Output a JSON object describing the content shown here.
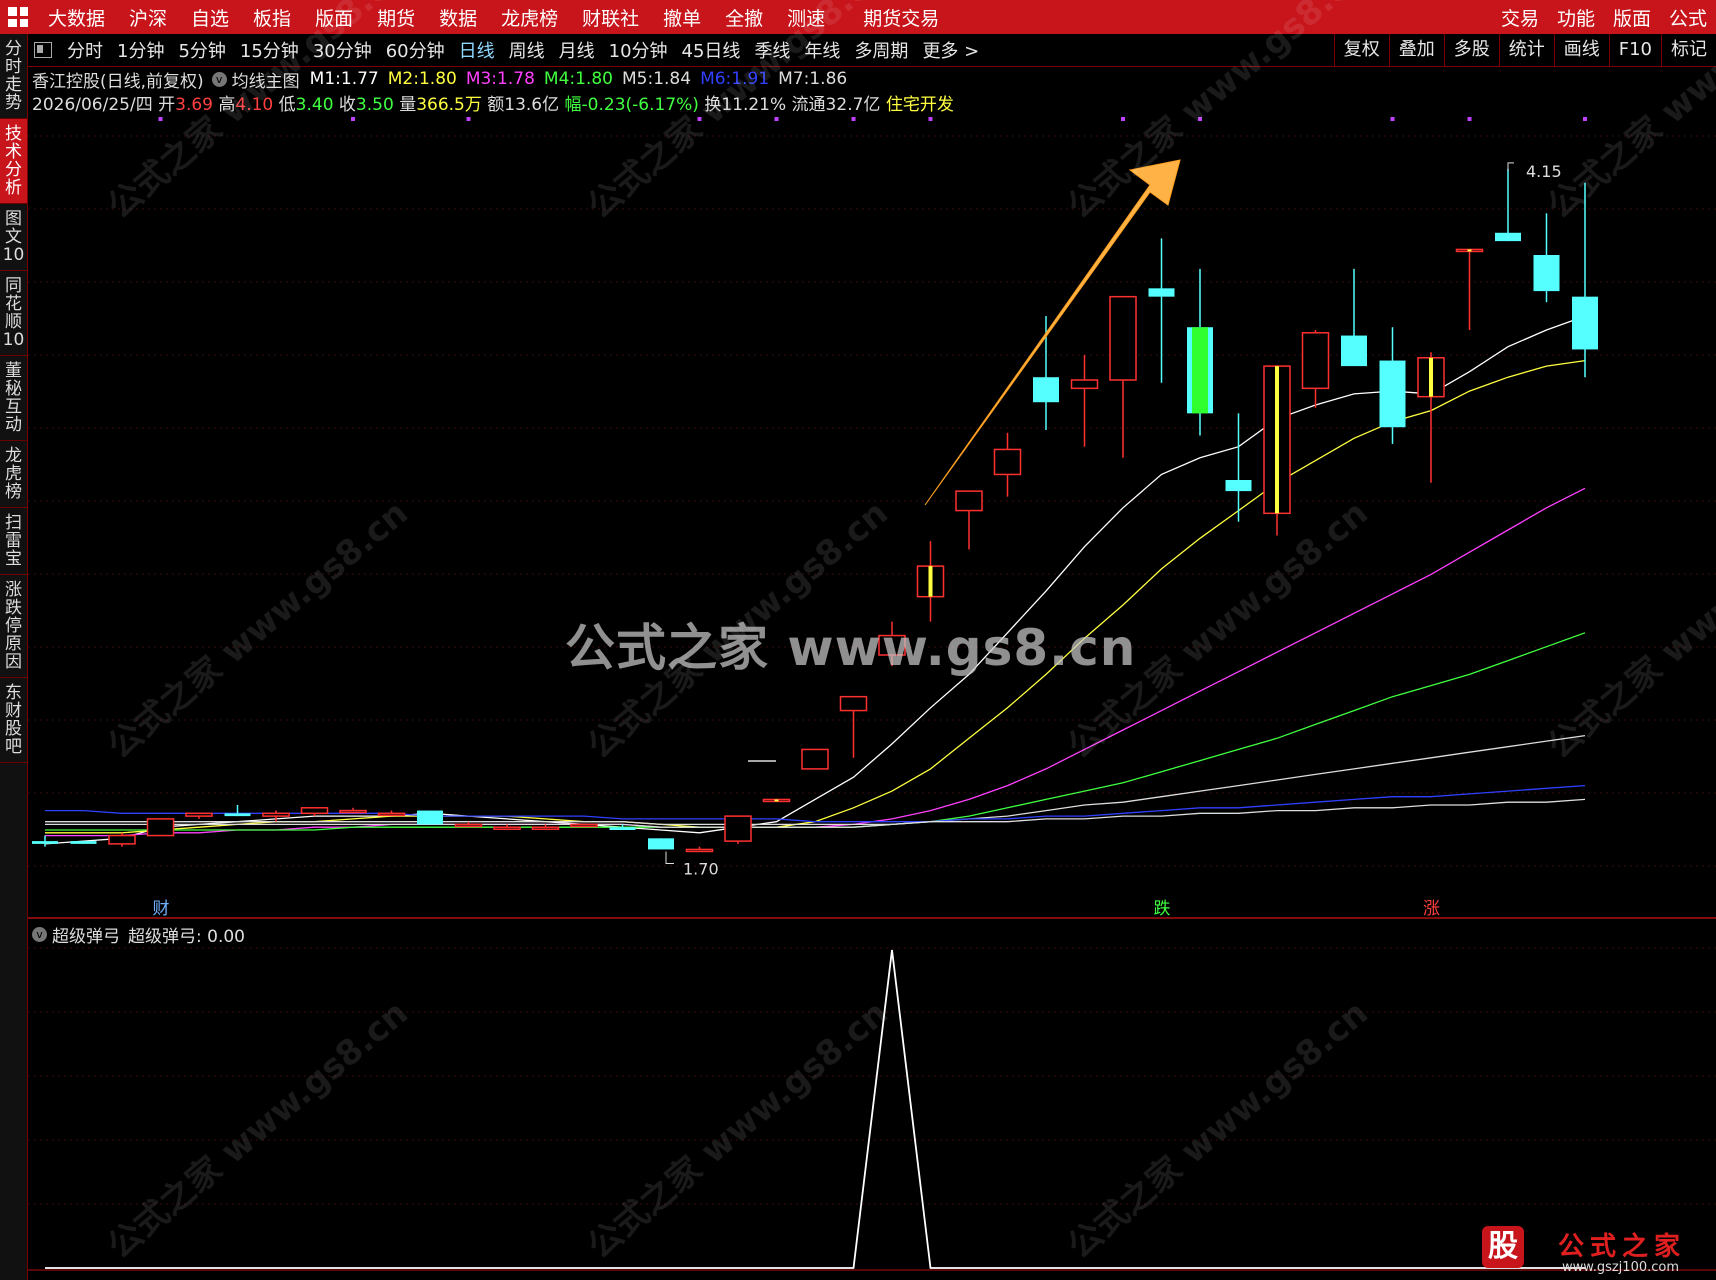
{
  "top_menu": {
    "left": [
      "大数据",
      "沪深",
      "自选",
      "板指",
      "版面",
      "期货",
      "数据",
      "龙虎榜",
      "财联社",
      "撤单",
      "全撤",
      "测速",
      "期货交易"
    ],
    "right": [
      "交易",
      "功能",
      "版面",
      "公式"
    ]
  },
  "toolbar": {
    "periods": [
      "分时",
      "1分钟",
      "5分钟",
      "15分钟",
      "30分钟",
      "60分钟",
      "日线",
      "周线",
      "月线",
      "10分钟",
      "45日线",
      "季线",
      "年线",
      "多周期",
      "更多 >"
    ],
    "active": "日线",
    "right": [
      "复权",
      "叠加",
      "多股",
      "统计",
      "画线",
      "F10",
      "标记"
    ]
  },
  "sidebar": {
    "tabs": [
      "分时走势",
      "技术分析",
      "图文10",
      "同花顺10",
      "董秘互动",
      "龙虎榜",
      "扫雷宝",
      "涨跌停原因",
      "东财股吧"
    ],
    "active": "技术分析"
  },
  "info": {
    "stock": "香江控股(日线,前复权)",
    "indicator": "均线主图",
    "ma": [
      {
        "label": "M1:",
        "value": "1.77",
        "color": "#ffffff"
      },
      {
        "label": "M2:",
        "value": "1.80",
        "color": "#ffff40"
      },
      {
        "label": "M3:",
        "value": "1.78",
        "color": "#ff40ff"
      },
      {
        "label": "M4:",
        "value": "1.80",
        "color": "#40ff40"
      },
      {
        "label": "M5:",
        "value": "1.84",
        "color": "#dddddd"
      },
      {
        "label": "M6:",
        "value": "1.91",
        "color": "#3040ff"
      },
      {
        "label": "M7:",
        "value": "1.86",
        "color": "#dddddd"
      }
    ],
    "line2": [
      {
        "text": "2026/06/25/四 ",
        "color": "#dddddd"
      },
      {
        "text": "开",
        "color": "#dddddd"
      },
      {
        "text": "3.69 ",
        "color": "#ff4040"
      },
      {
        "text": "高",
        "color": "#dddddd"
      },
      {
        "text": "4.10 ",
        "color": "#ff4040"
      },
      {
        "text": "低",
        "color": "#dddddd"
      },
      {
        "text": "3.40 ",
        "color": "#40ff40"
      },
      {
        "text": "收",
        "color": "#dddddd"
      },
      {
        "text": "3.50 ",
        "color": "#40ff40"
      },
      {
        "text": "量",
        "color": "#dddddd"
      },
      {
        "text": "366.5万 ",
        "color": "#ffff40"
      },
      {
        "text": "额13.6亿 ",
        "color": "#dddddd"
      },
      {
        "text": "幅-0.23(-6.17%) ",
        "color": "#40ff40"
      },
      {
        "text": "换11.21% ",
        "color": "#dddddd"
      },
      {
        "text": "流通32.7亿 ",
        "color": "#dddddd"
      },
      {
        "text": "住宅开发",
        "color": "#ffff40"
      }
    ]
  },
  "chart_data": [
    {
      "type": "candlestick",
      "title": "香江控股(日线,前复权)",
      "candles": [
        {
          "o": 1.73,
          "h": 1.75,
          "l": 1.71,
          "c": 1.72
        },
        {
          "o": 1.73,
          "h": 1.73,
          "l": 1.72,
          "c": 1.72
        },
        {
          "o": 1.72,
          "h": 1.76,
          "l": 1.71,
          "c": 1.75
        },
        {
          "o": 1.75,
          "h": 1.81,
          "l": 1.75,
          "c": 1.81
        },
        {
          "o": 1.82,
          "h": 1.83,
          "l": 1.81,
          "c": 1.83
        },
        {
          "o": 1.83,
          "h": 1.86,
          "l": 1.82,
          "c": 1.82
        },
        {
          "o": 1.82,
          "h": 1.84,
          "l": 1.8,
          "c": 1.83
        },
        {
          "o": 1.83,
          "h": 1.85,
          "l": 1.82,
          "c": 1.85
        },
        {
          "o": 1.84,
          "h": 1.85,
          "l": 1.83,
          "c": 1.84
        },
        {
          "o": 1.83,
          "h": 1.84,
          "l": 1.82,
          "c": 1.83
        },
        {
          "o": 1.84,
          "h": 1.84,
          "l": 1.79,
          "c": 1.79
        },
        {
          "o": 1.79,
          "h": 1.8,
          "l": 1.78,
          "c": 1.79
        },
        {
          "o": 1.78,
          "h": 1.79,
          "l": 1.77,
          "c": 1.78
        },
        {
          "o": 1.78,
          "h": 1.79,
          "l": 1.77,
          "c": 1.78
        },
        {
          "o": 1.79,
          "h": 1.79,
          "l": 1.78,
          "c": 1.79
        },
        {
          "o": 1.78,
          "h": 1.79,
          "l": 1.77,
          "c": 1.77
        },
        {
          "o": 1.74,
          "h": 1.74,
          "l": 1.7,
          "c": 1.7
        },
        {
          "o": 1.7,
          "h": 1.71,
          "l": 1.7,
          "c": 1.7
        },
        {
          "o": 1.73,
          "h": 1.82,
          "l": 1.72,
          "c": 1.82
        },
        {
          "o": 1.88,
          "h": 1.88,
          "l": 1.88,
          "c": 1.88
        },
        {
          "o": 1.99,
          "h": 2.06,
          "l": 1.99,
          "c": 2.06
        },
        {
          "o": 2.2,
          "h": 2.25,
          "l": 2.03,
          "c": 2.25
        },
        {
          "o": 2.4,
          "h": 2.52,
          "l": 2.36,
          "c": 2.47
        },
        {
          "o": 2.61,
          "h": 2.81,
          "l": 2.52,
          "c": 2.72
        },
        {
          "o": 2.92,
          "h": 2.99,
          "l": 2.78,
          "c": 2.99
        },
        {
          "o": 3.05,
          "h": 3.2,
          "l": 2.97,
          "c": 3.14
        },
        {
          "o": 3.4,
          "h": 3.62,
          "l": 3.21,
          "c": 3.31
        },
        {
          "o": 3.36,
          "h": 3.48,
          "l": 3.15,
          "c": 3.39
        },
        {
          "o": 3.39,
          "h": 3.66,
          "l": 3.11,
          "c": 3.69
        },
        {
          "o": 3.72,
          "h": 3.9,
          "l": 3.38,
          "c": 3.69
        },
        {
          "o": 3.58,
          "h": 3.79,
          "l": 3.19,
          "c": 3.27
        },
        {
          "o": 3.03,
          "h": 3.27,
          "l": 2.88,
          "c": 2.99
        },
        {
          "o": 2.91,
          "h": 3.44,
          "l": 2.83,
          "c": 3.44
        },
        {
          "o": 3.36,
          "h": 3.57,
          "l": 3.29,
          "c": 3.56
        },
        {
          "o": 3.55,
          "h": 3.79,
          "l": 3.46,
          "c": 3.44
        },
        {
          "o": 3.46,
          "h": 3.58,
          "l": 3.16,
          "c": 3.22
        },
        {
          "o": 3.33,
          "h": 3.49,
          "l": 3.02,
          "c": 3.47
        },
        {
          "o": 3.86,
          "h": 3.86,
          "l": 3.57,
          "c": 3.86
        },
        {
          "o": 3.92,
          "h": 4.15,
          "l": 3.89,
          "c": 3.89
        },
        {
          "o": 3.84,
          "h": 3.99,
          "l": 3.67,
          "c": 3.71
        },
        {
          "o": 3.69,
          "h": 4.1,
          "l": 3.4,
          "c": 3.5
        }
      ],
      "ma_series": [
        {
          "name": "M1",
          "color": "#ffffff",
          "values": [
            1.72,
            1.73,
            1.74,
            1.78,
            1.79,
            1.8,
            1.81,
            1.82,
            1.82,
            1.82,
            1.83,
            1.82,
            1.81,
            1.8,
            1.79,
            1.78,
            1.77,
            1.76,
            1.78,
            1.8,
            1.88,
            1.96,
            2.08,
            2.21,
            2.33,
            2.48,
            2.63,
            2.79,
            2.93,
            3.05,
            3.11,
            3.15,
            3.25,
            3.3,
            3.34,
            3.35,
            3.34,
            3.42,
            3.51,
            3.57,
            3.62
          ]
        },
        {
          "name": "M2",
          "color": "#ffff40",
          "values": [
            1.76,
            1.76,
            1.76,
            1.77,
            1.78,
            1.79,
            1.8,
            1.8,
            1.81,
            1.82,
            1.82,
            1.82,
            1.82,
            1.81,
            1.8,
            1.8,
            1.79,
            1.78,
            1.78,
            1.78,
            1.8,
            1.85,
            1.91,
            1.99,
            2.1,
            2.21,
            2.33,
            2.46,
            2.58,
            2.71,
            2.82,
            2.92,
            3.02,
            3.1,
            3.18,
            3.24,
            3.28,
            3.35,
            3.4,
            3.44,
            3.46
          ]
        },
        {
          "name": "M3",
          "color": "#ff40ff",
          "values": [
            1.75,
            1.75,
            1.75,
            1.76,
            1.76,
            1.77,
            1.77,
            1.78,
            1.78,
            1.79,
            1.79,
            1.79,
            1.79,
            1.79,
            1.79,
            1.79,
            1.78,
            1.78,
            1.78,
            1.78,
            1.78,
            1.79,
            1.81,
            1.84,
            1.88,
            1.93,
            1.99,
            2.06,
            2.13,
            2.2,
            2.27,
            2.34,
            2.41,
            2.48,
            2.55,
            2.62,
            2.69,
            2.77,
            2.85,
            2.93,
            3.0
          ]
        },
        {
          "name": "M4",
          "color": "#40ff40",
          "values": [
            1.77,
            1.77,
            1.77,
            1.77,
            1.77,
            1.77,
            1.77,
            1.77,
            1.78,
            1.78,
            1.78,
            1.78,
            1.78,
            1.78,
            1.78,
            1.78,
            1.78,
            1.78,
            1.78,
            1.78,
            1.78,
            1.78,
            1.79,
            1.8,
            1.82,
            1.85,
            1.88,
            1.91,
            1.94,
            1.98,
            2.02,
            2.06,
            2.1,
            2.15,
            2.2,
            2.25,
            2.29,
            2.33,
            2.38,
            2.43,
            2.48
          ]
        },
        {
          "name": "M5",
          "color": "#dddddd",
          "values": [
            1.79,
            1.79,
            1.79,
            1.79,
            1.79,
            1.79,
            1.79,
            1.79,
            1.79,
            1.79,
            1.79,
            1.79,
            1.79,
            1.79,
            1.79,
            1.79,
            1.78,
            1.78,
            1.78,
            1.78,
            1.78,
            1.78,
            1.79,
            1.8,
            1.81,
            1.82,
            1.84,
            1.86,
            1.87,
            1.89,
            1.91,
            1.93,
            1.95,
            1.97,
            1.99,
            2.01,
            2.03,
            2.05,
            2.07,
            2.09,
            2.11
          ]
        },
        {
          "name": "M6",
          "color": "#3040ff",
          "values": [
            1.84,
            1.84,
            1.83,
            1.83,
            1.83,
            1.83,
            1.83,
            1.83,
            1.83,
            1.83,
            1.82,
            1.82,
            1.82,
            1.82,
            1.82,
            1.81,
            1.81,
            1.81,
            1.81,
            1.81,
            1.8,
            1.8,
            1.8,
            1.8,
            1.81,
            1.81,
            1.82,
            1.82,
            1.83,
            1.84,
            1.85,
            1.85,
            1.86,
            1.87,
            1.88,
            1.89,
            1.89,
            1.9,
            1.91,
            1.92,
            1.93
          ]
        },
        {
          "name": "M7",
          "color": "#dddddd",
          "values": [
            1.8,
            1.8,
            1.8,
            1.8,
            1.8,
            1.8,
            1.8,
            1.8,
            1.8,
            1.8,
            1.8,
            1.8,
            1.8,
            1.8,
            1.8,
            1.8,
            1.79,
            1.79,
            1.79,
            1.79,
            1.79,
            1.79,
            1.79,
            1.8,
            1.8,
            1.8,
            1.81,
            1.81,
            1.82,
            1.82,
            1.83,
            1.83,
            1.84,
            1.84,
            1.85,
            1.85,
            1.86,
            1.86,
            1.87,
            1.87,
            1.88
          ]
        }
      ],
      "annotations": {
        "high_label": "4.15",
        "low_label": "1.70",
        "markers": [
          {
            "index": 3,
            "text": "财",
            "color": "#6fb0ff"
          },
          {
            "index": 29,
            "text": "跌",
            "color": "#40ff40"
          },
          {
            "index": 36,
            "text": "涨",
            "color": "#ff4040"
          }
        ]
      }
    },
    {
      "type": "line",
      "title": "超级弹弓",
      "value_label": "超级弹弓: 0.00",
      "values": [
        0,
        0,
        0,
        0,
        0,
        0,
        0,
        0,
        0,
        0,
        0,
        0,
        0,
        0,
        0,
        0,
        0,
        0,
        0,
        0,
        0,
        0,
        1,
        0,
        0,
        0,
        0,
        0,
        0,
        0,
        0,
        0,
        0,
        0,
        0,
        0,
        0,
        0,
        0,
        0,
        0
      ]
    }
  ],
  "watermark": {
    "main": "公式之家 www.gs8.cn",
    "tile": "公式之家 www.gs8.cn"
  },
  "brand": {
    "mark": "股",
    "name": "公式之家",
    "url": "www.gszj100.com"
  },
  "colors": {
    "up": "#ff3030",
    "down": "#55ffff",
    "bg": "#000000",
    "menubar": "#c8141b"
  }
}
